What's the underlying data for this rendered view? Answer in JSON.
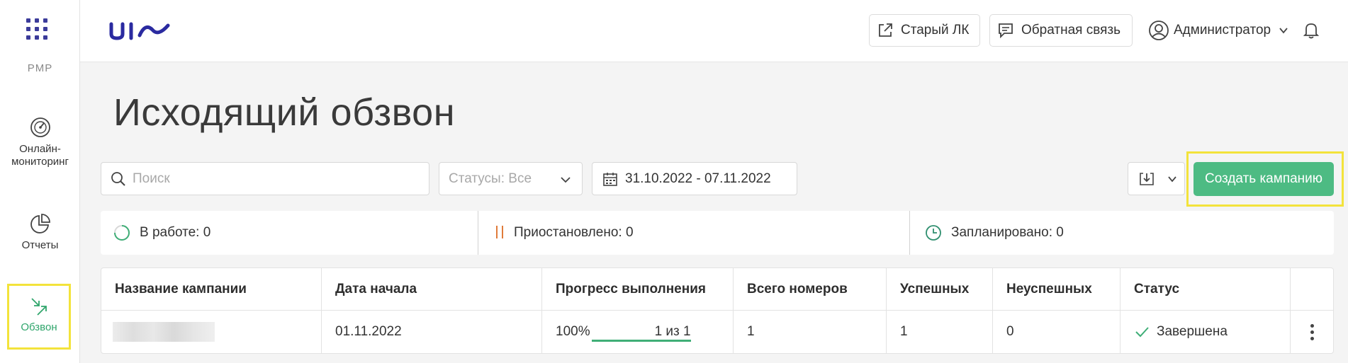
{
  "sidebar": {
    "org": "PMP",
    "items": [
      {
        "label": "Онлайн-\nмониторинг",
        "icon": "gauge-icon"
      },
      {
        "label": "Отчеты",
        "icon": "reports-icon"
      },
      {
        "label": "Обзвон",
        "icon": "outbound-call-icon",
        "active": true
      }
    ]
  },
  "header": {
    "old_cabinet": "Старый ЛК",
    "feedback": "Обратная связь",
    "user": "Администратор"
  },
  "page": {
    "title": "Исходящий обзвон"
  },
  "filters": {
    "search_placeholder": "Поиск",
    "status_select": "Статусы: Все",
    "date_range": "31.10.2022 - 07.11.2022"
  },
  "actions": {
    "create": "Создать кампанию"
  },
  "summary": {
    "in_progress": "В работе: 0",
    "paused": "Приостановлено: 0",
    "scheduled": "Запланировано: 0"
  },
  "table": {
    "headers": [
      "Название кампании",
      "Дата начала",
      "Прогресс выполнения",
      "Всего номеров",
      "Успешных",
      "Неуспешных",
      "Статус"
    ],
    "rows": [
      {
        "start_date": "01.11.2022",
        "progress_pct": "100%",
        "progress_count": "1 из 1",
        "progress_fraction": 1.0,
        "total": "1",
        "success": "1",
        "failed": "0",
        "status": "Завершена"
      }
    ]
  },
  "colors": {
    "brand": "#2a2aa0",
    "accent_green": "#4dbb83",
    "highlight": "#f3e33b",
    "paused_orange": "#e07b3a",
    "scheduled_teal": "#2f8f6f"
  }
}
